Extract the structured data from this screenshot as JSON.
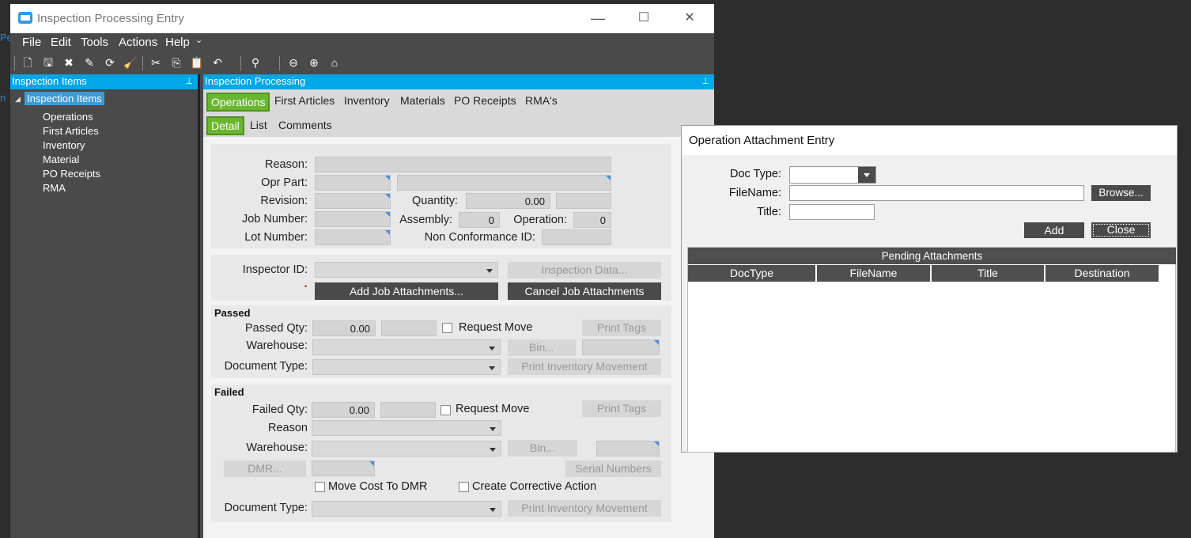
{
  "window": {
    "title": "Inspection Processing Entry",
    "minimize": "—",
    "maximize": "☐",
    "close": "✕"
  },
  "menu": [
    "File",
    "Edit",
    "Tools",
    "Actions",
    "Help"
  ],
  "left_panel": {
    "title": "Inspection Items",
    "tree_root": "Inspection Items",
    "tree_items": [
      "Operations",
      "First Articles",
      "Inventory",
      "Material",
      "PO Receipts",
      "RMA"
    ]
  },
  "right_panel": {
    "title": "Inspection Processing"
  },
  "tabs": [
    "Operations",
    "First Articles",
    "Inventory",
    "Materials",
    "PO Receipts",
    "RMA's"
  ],
  "subtabs": [
    "Detail",
    "List",
    "Comments"
  ],
  "form": {
    "reason_label": "Reason:",
    "opr_part_label": "Opr Part:",
    "revision_label": "Revision:",
    "quantity_label": "Quantity:",
    "quantity_value": "0.00",
    "job_number_label": "Job Number:",
    "assembly_label": "Assembly:",
    "assembly_value": "0",
    "operation_label": "Operation:",
    "operation_value": "0",
    "lot_number_label": "Lot Number:",
    "ncr_label": "Non Conformance ID:",
    "inspector_label": "Inspector ID:",
    "inspection_data_btn": "Inspection Data...",
    "required_mark": "•",
    "add_attach_btn": "Add Job Attachments...",
    "cancel_attach_btn": "Cancel Job Attachments",
    "passed": {
      "title": "Passed",
      "qty_label": "Passed Qty:",
      "qty_value": "0.00",
      "request_move": "Request Move",
      "print_tags": "Print Tags",
      "warehouse_label": "Warehouse:",
      "bin_btn": "Bin...",
      "doc_type_label": "Document Type:",
      "print_inv": "Print Inventory Movement"
    },
    "failed": {
      "title": "Failed",
      "qty_label": "Failed Qty:",
      "qty_value": "0.00",
      "request_move": "Request Move",
      "print_tags": "Print Tags",
      "reason_label": "Reason",
      "warehouse_label": "Warehouse:",
      "bin_btn": "Bin...",
      "dmr_btn": "DMR...",
      "serial_btn": "Serial Numbers",
      "move_cost": "Move Cost To DMR",
      "corrective": "Create Corrective Action",
      "doc_type_label": "Document Type:",
      "print_inv": "Print Inventory Movement"
    }
  },
  "dialog": {
    "title": "Operation Attachment Entry",
    "doc_type_label": "Doc Type:",
    "filename_label": "FileName:",
    "title_label": "Title:",
    "browse_btn": "Browse...",
    "add_btn": "Add",
    "close_btn": "Close",
    "pending_title": "Pending Attachments",
    "columns": [
      "DocType",
      "FileName",
      "Title",
      "Destination"
    ]
  },
  "edge_text": {
    "a": "Pe",
    "b": "n"
  }
}
